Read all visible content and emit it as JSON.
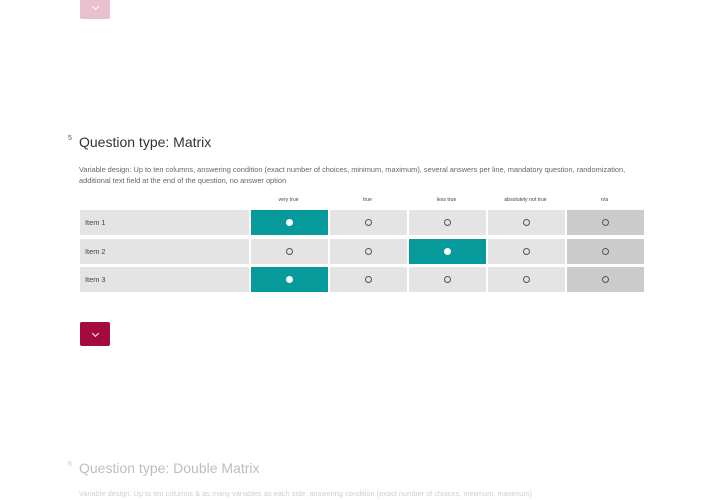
{
  "top_nav": {
    "icon": "chevron-down-icon"
  },
  "question5": {
    "number": "5",
    "title": "Question type: Matrix",
    "description": "Variable design: Up to ten columns, answering condition (exact number of choices, minimum, maximum), several answers per line, mandatory question, randomization, additional text field at the end of the question, no answer option",
    "columns": [
      "very true",
      "true",
      "less true",
      "absolutely not true",
      "n/a"
    ],
    "rows": [
      {
        "label": "Item 1",
        "selected_column": "very true"
      },
      {
        "label": "Item 2",
        "selected_column": "less true"
      },
      {
        "label": "Item 3",
        "selected_column": "very true"
      }
    ]
  },
  "next_button": {
    "icon": "chevron-down-icon"
  },
  "question6": {
    "number": "6",
    "title": "Question type: Double Matrix",
    "description": "Variable design: Up to ten columns & as many variables as each side, answering condition (exact number of choices, minimum, maximum)"
  },
  "colors": {
    "accent": "#a30b3e",
    "selected": "#069b9a",
    "cell": "#e4e4e4",
    "na_cell": "#cbcbcb"
  }
}
